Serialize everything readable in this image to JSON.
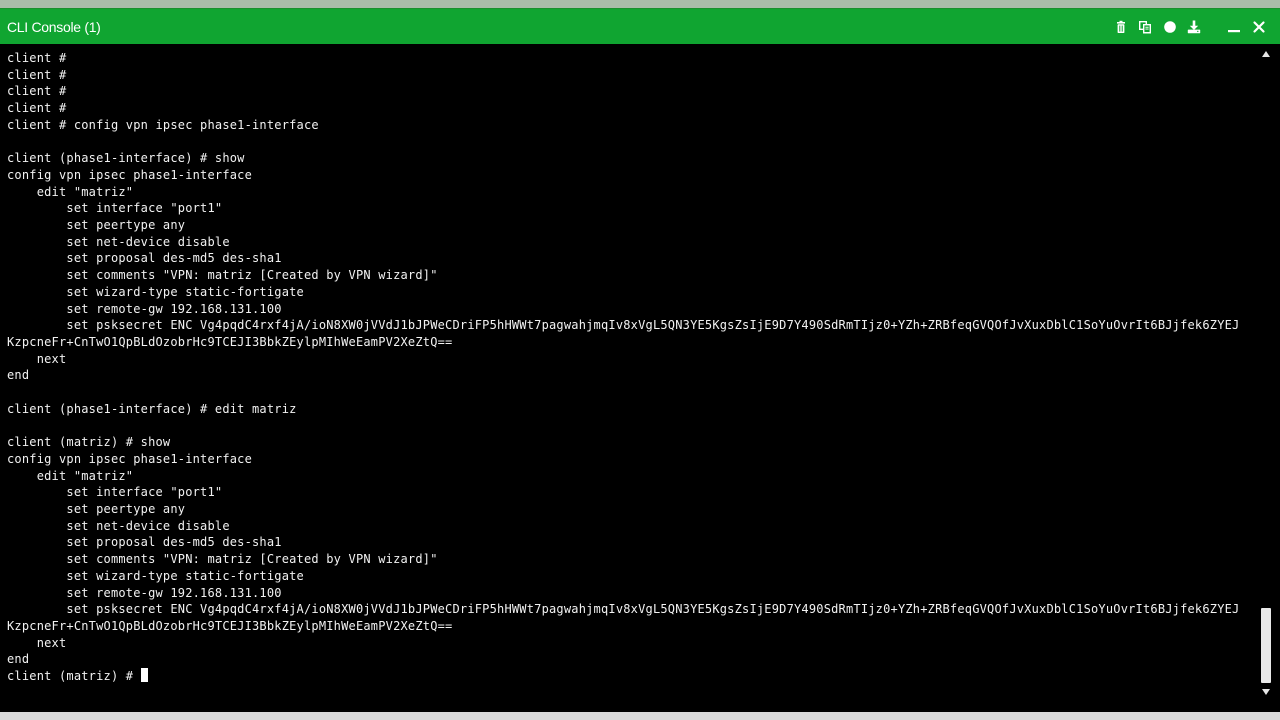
{
  "window": {
    "title": "CLI Console (1)"
  },
  "toolbar": {
    "icons": [
      "trash-icon",
      "copy-icon",
      "record-icon",
      "download-icon",
      "minimize-icon",
      "close-icon"
    ]
  },
  "console": {
    "output": "client #\nclient #\nclient #\nclient #\nclient # config vpn ipsec phase1-interface\n\nclient (phase1-interface) # show\nconfig vpn ipsec phase1-interface\n    edit \"matriz\"\n        set interface \"port1\"\n        set peertype any\n        set net-device disable\n        set proposal des-md5 des-sha1\n        set comments \"VPN: matriz [Created by VPN wizard]\"\n        set wizard-type static-fortigate\n        set remote-gw 192.168.131.100\n        set psksecret ENC Vg4pqdC4rxf4jA/ioN8XW0jVVdJ1bJPWeCDriFP5hHWWt7pagwahjmqIv8xVgL5QN3YE5KgsZsIjE9D7Y490SdRmTIjz0+YZh+ZRBfeqGVQOfJvXuxDblC1SoYuOvrIt6BJjfek6ZYEJ\nKzpcneFr+CnTwO1QpBLdOzobrHc9TCEJI3BbkZEylpMIhWeEamPV2XeZtQ==\n    next\nend\n\nclient (phase1-interface) # edit matriz\n\nclient (matriz) # show\nconfig vpn ipsec phase1-interface\n    edit \"matriz\"\n        set interface \"port1\"\n        set peertype any\n        set net-device disable\n        set proposal des-md5 des-sha1\n        set comments \"VPN: matriz [Created by VPN wizard]\"\n        set wizard-type static-fortigate\n        set remote-gw 192.168.131.100\n        set psksecret ENC Vg4pqdC4rxf4jA/ioN8XW0jVVdJ1bJPWeCDriFP5hHWWt7pagwahjmqIv8xVgL5QN3YE5KgsZsIjE9D7Y490SdRmTIjz0+YZh+ZRBfeqGVQOfJvXuxDblC1SoYuOvrIt6BJjfek6ZYEJ\nKzpcneFr+CnTwO1QpBLdOzobrHc9TCEJI3BbkZEylpMIhWeEamPV2XeZtQ==\n    next\nend\n",
    "prompt": "client (matriz) # "
  },
  "colors": {
    "titlebar": "#10a531",
    "console_bg": "#000000",
    "console_fg": "#f2f2f2"
  }
}
